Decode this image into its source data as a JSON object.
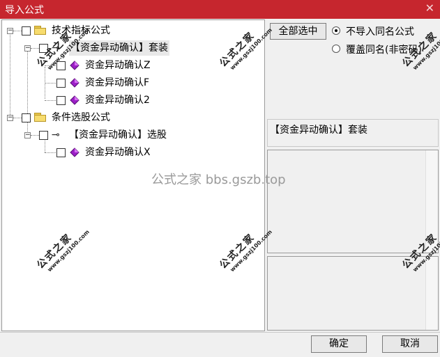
{
  "window": {
    "title": "导入公式",
    "close_glyph": "✕"
  },
  "tree": {
    "groups": [
      {
        "label": "技术指标公式",
        "expander": "−",
        "children": [
          {
            "label": "【资金异动确认】套装",
            "expander": "−",
            "children": [
              {
                "label": "资金异动确认Z"
              },
              {
                "label": "资金异动确认F"
              },
              {
                "label": "资金异动确认2"
              }
            ]
          }
        ]
      },
      {
        "label": "条件选股公式",
        "expander": "−",
        "children": [
          {
            "label": "【资金异动确认】选股",
            "expander": "−",
            "icon": "⊸",
            "children": [
              {
                "label": "资金异动确认X"
              }
            ]
          }
        ]
      }
    ]
  },
  "right": {
    "select_all_label": "全部选中",
    "radio_no_import": "不导入同名公式",
    "radio_overwrite": "覆盖同名(非密码)",
    "selected_name": "【资金异动确认】套装"
  },
  "footer": {
    "ok_label": "确定",
    "cancel_label": "取消"
  },
  "watermark": {
    "text": "公式之家",
    "url": "www.gszj100.com",
    "center": "公式之家 bbs.gszb.top"
  },
  "colors": {
    "titlebar": "#c6262e",
    "gem": "#9b1fc6"
  }
}
